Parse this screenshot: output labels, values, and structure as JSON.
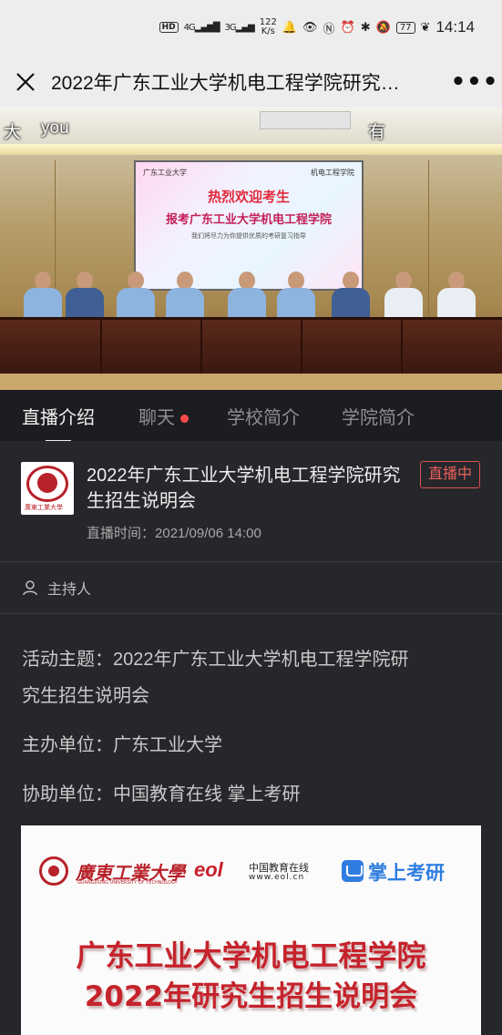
{
  "status_bar": {
    "hd": "HD",
    "net1": "4G",
    "net2": "3G",
    "speed_value": "122",
    "speed_unit": "K/s",
    "battery": "77",
    "time": "14:14"
  },
  "header": {
    "close_icon": "close-icon",
    "title": "2022年广东工业大学机电工程学院研究…",
    "more_icon": "more-dots-icon"
  },
  "video": {
    "caption_left": "大",
    "caption_mid": "you",
    "caption_right": "有",
    "screen_logo_left": "广东工业大学",
    "screen_logo_right": "机电工程学院",
    "screen_line1": "热烈欢迎考生",
    "screen_line2": "报考广东工业大学机电工程学院",
    "screen_line3": "我们将尽力为你提供优质的考研复习指导"
  },
  "tabs": [
    {
      "label": "直播介绍",
      "active": true
    },
    {
      "label": "聊天",
      "dot": true
    },
    {
      "label": "学校简介"
    },
    {
      "label": "学院简介"
    }
  ],
  "event": {
    "title": "2022年广东工业大学机电工程学院研究生招生说明会",
    "badge": "直播中",
    "time_label": "直播时间：",
    "time_value": "2021/09/06 14:00",
    "logo_text": "廣東工業大學"
  },
  "host": {
    "label": "主持人"
  },
  "details": {
    "line1": "活动主题：2022年广东工业大学机电工程学院研",
    "line2": "究生招生说明会",
    "line3": "主办单位：广东工业大学",
    "line4": "协助单位：中国教育在线 掌上考研"
  },
  "poster": {
    "gdut_name": "廣東工業大學",
    "gdut_sub": "GUANGDONG UNIVERSITY OF TECHNOLOGY",
    "eol_mark": "eol",
    "eol_name": "中国教育在线",
    "eol_url": "www.eol.cn",
    "zskyan_name": "掌上考研",
    "title_line1": "广东工业大学机电工程学院",
    "title_line2": "2022年研究生招生说明会"
  },
  "colors": {
    "bg": "#26272b",
    "tab_bar": "#1c1d20",
    "live_red": "#e8605c",
    "poster_red": "#c5232c"
  }
}
